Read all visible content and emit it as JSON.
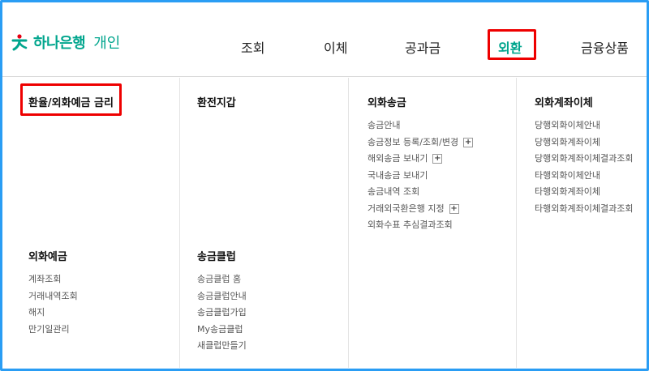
{
  "brand": {
    "name": "하나은행",
    "sub": "개인",
    "color": "#00a58d",
    "logo_icon": "hana-logo-icon"
  },
  "nav": {
    "items": [
      {
        "label": "조회"
      },
      {
        "label": "이체"
      },
      {
        "label": "공과금"
      },
      {
        "label": "외환",
        "active": true
      },
      {
        "label": "금융상품"
      }
    ]
  },
  "menu": {
    "fx_rate": {
      "title": "환율/외화예금 금리"
    },
    "fx_deposit": {
      "title": "외화예금",
      "items": [
        "계좌조회",
        "거래내역조회",
        "해지",
        "만기일관리"
      ]
    },
    "exchange_wallet": {
      "title": "환전지갑"
    },
    "remit_club": {
      "title": "송금클럽",
      "items": [
        "송금클럽 홈",
        "송금클럽안내",
        "송금클럽가입",
        "My송금클럽",
        "새클럽만들기"
      ]
    },
    "fx_remit": {
      "title": "외화송금",
      "items": [
        {
          "label": "송금안내",
          "expandable": false
        },
        {
          "label": "송금정보 등록/조회/변경",
          "expandable": true
        },
        {
          "label": "해외송금 보내기",
          "expandable": true
        },
        {
          "label": "국내송금 보내기",
          "expandable": false
        },
        {
          "label": "송금내역 조회",
          "expandable": false
        },
        {
          "label": "거래외국환은행 지정",
          "expandable": true
        },
        {
          "label": "외화수표 추심결과조회",
          "expandable": false
        }
      ],
      "plus_symbol": "+"
    },
    "fx_account_transfer": {
      "title": "외화계좌이체",
      "items": [
        "당행외화이체안내",
        "당행외화계좌이체",
        "당행외화계좌이체결과조회",
        "타행외화이체안내",
        "타행외화계좌이체",
        "타행외화계좌이체결과조회"
      ]
    }
  },
  "colors": {
    "highlight": "#ee0000",
    "frame": "#2a9df4"
  }
}
